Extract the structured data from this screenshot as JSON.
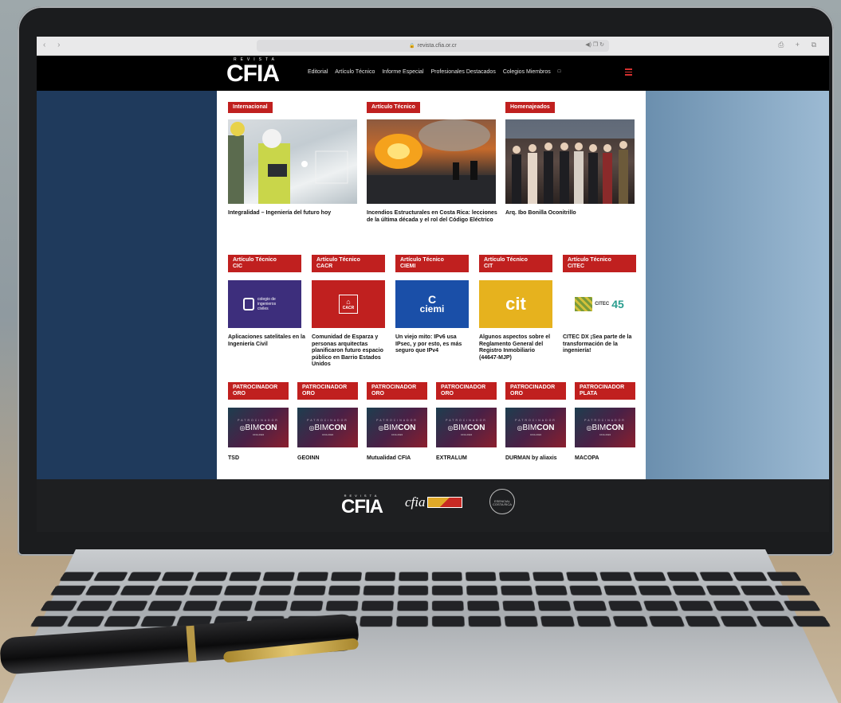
{
  "browser": {
    "url": "revista.cfia.or.cr",
    "lock": "🔒",
    "url_right": "◀) ❐ ↻",
    "actions": "⎙ + ⧉",
    "nav": "‹ ›"
  },
  "header": {
    "logo_small": "REVISTA",
    "logo_big": "CFIA",
    "menu": [
      "Editorial",
      "Artículo Técnico",
      "Informe Especial",
      "Profesionales Destacados",
      "Colegios Miembros"
    ],
    "menu_ext_icon": "external-link-icon"
  },
  "featured": [
    {
      "tag": "Internacional",
      "title": "Integralidad – Ingeniería del futuro hoy",
      "image": "engineers-photo"
    },
    {
      "tag": "Artículo Técnico",
      "title": "Incendios Estructurales en Costa Rica: lecciones de la última década y el rol del Código Eléctrico",
      "image": "fire-photo"
    },
    {
      "tag": "Homenajeados",
      "title": "Arq. Ibo Bonilla Oconitrillo",
      "image": "group-photo"
    }
  ],
  "technical": [
    {
      "tag_line1": "Artículo Técnico",
      "tag_line2": "CIC",
      "logo_text": "colegio de ingenieros civiles",
      "title": "Aplicaciones satelitales en la Ingeniería Civil",
      "color": "#3d2e7c"
    },
    {
      "tag_line1": "Artículo Técnico",
      "tag_line2": "CACR",
      "logo_text": "CACR",
      "title": "Comunidad de Esparza y personas arquitectas planificaron futuro espacio público en Barrio Estados Unidos",
      "color": "#c0201f"
    },
    {
      "tag_line1": "Artículo Técnico",
      "tag_line2": "CIEMI",
      "logo_text": "ciemi",
      "title": "Un viejo mito: IPv6 usa IPsec, y por esto, es más seguro que IPv4",
      "color": "#1a4fa8"
    },
    {
      "tag_line1": "Artículo Técnico",
      "tag_line2": "CIT",
      "logo_text": "cit",
      "title": "Algunos aspectos sobre el Reglamento General del Registro Inmobiliario (44647-MJP)",
      "color": "#e6b21e"
    },
    {
      "tag_line1": "Artículo Técnico",
      "tag_line2": "CITEC",
      "logo_text": "CITEC",
      "logo_number": "45",
      "title": "CITEC DX ¡Sea parte de la transformación de la ingeniería!",
      "color": "#ffffff"
    }
  ],
  "sponsors": [
    {
      "tag_line1": "PATROCINADOR",
      "tag_line2": "ORO",
      "name": "TSD"
    },
    {
      "tag_line1": "PATROCINADOR",
      "tag_line2": "ORO",
      "name": "GEOINN"
    },
    {
      "tag_line1": "PATROCINADOR",
      "tag_line2": "ORO",
      "name": "Mutualidad CFIA"
    },
    {
      "tag_line1": "PATROCINADOR",
      "tag_line2": "ORO",
      "name": "EXTRALUM"
    },
    {
      "tag_line1": "PATROCINADOR",
      "tag_line2": "ORO",
      "name": "DURMAN by aliaxis"
    },
    {
      "tag_line1": "PATROCINADOR",
      "tag_line2": "PLATA",
      "name": "MACOPA"
    }
  ],
  "sponsor_banner": {
    "top": "PATROCINADOR",
    "brand_a": "BIM",
    "brand_b": "CON",
    "sub": "CFIA 2024"
  },
  "footer": {
    "logo_small": "REVISTA",
    "logo_big": "CFIA",
    "cfia_script": "cfia",
    "seal_text": "ESENCIAL COSTA RICA"
  },
  "colors": {
    "accent": "#c0201f",
    "header_bg": "#000000",
    "page_left": "#1f3a5c"
  }
}
